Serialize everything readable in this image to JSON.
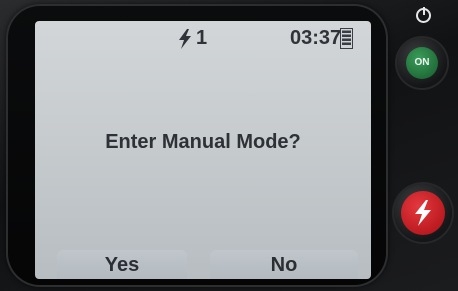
{
  "status_bar": {
    "shock_count": "1",
    "time": "03:37"
  },
  "dialog": {
    "message": "Enter Manual Mode?",
    "yes_label": "Yes",
    "no_label": "No"
  },
  "hardware": {
    "on_label": "ON",
    "on_color": "#2f8a4c",
    "shock_color": "#d42a30"
  },
  "icons": {
    "shock": "lightning-bolt-icon",
    "battery": "battery-icon",
    "power": "power-icon"
  }
}
